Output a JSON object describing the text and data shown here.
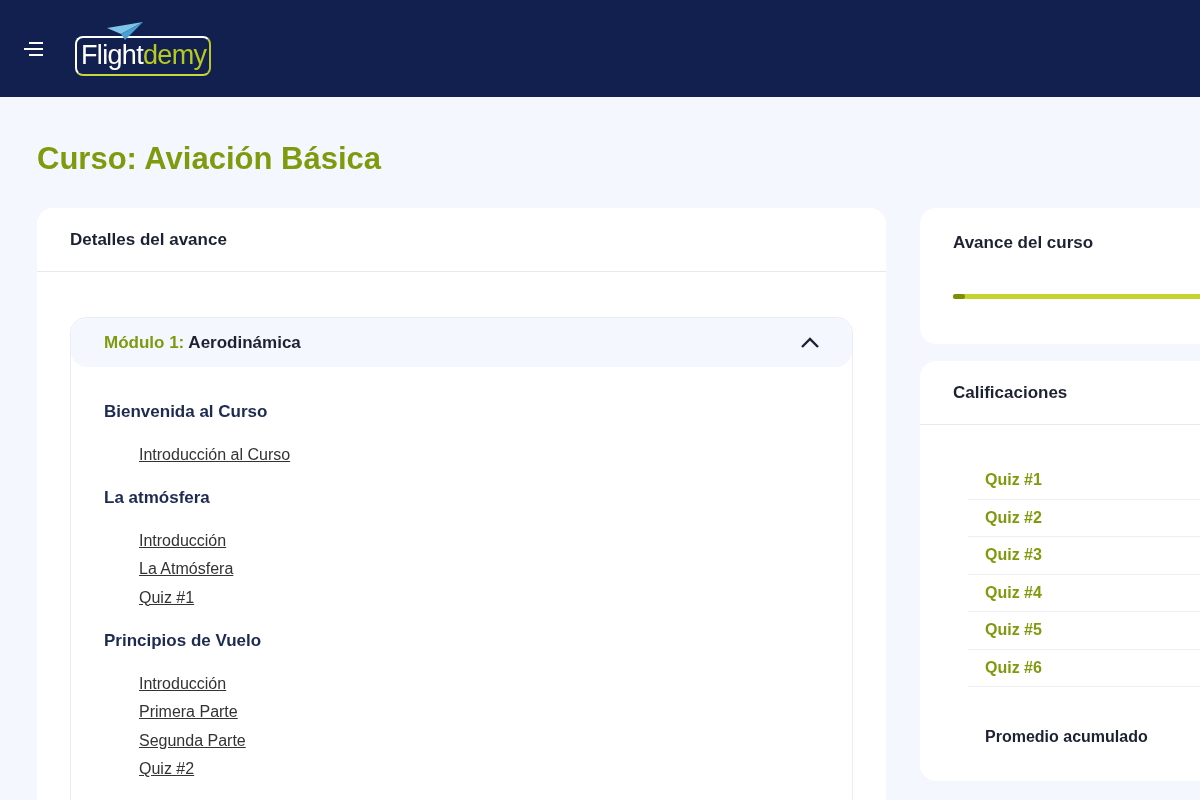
{
  "header": {
    "logo": {
      "part_1": "Flight",
      "part_2": "demy"
    }
  },
  "page_title": "Curso: Aviación Básica",
  "details_card": {
    "title": "Detalles del avance",
    "module": {
      "label": "Módulo 1:",
      "name": "Aerodinámica",
      "expanded": true,
      "sections": [
        {
          "title": "Bienvenida al Curso",
          "lessons": [
            "Introducción al Curso"
          ]
        },
        {
          "title": "La atmósfera",
          "lessons": [
            "Introducción",
            "La Atmósfera",
            "Quiz #1"
          ]
        },
        {
          "title": "Principios de Vuelo",
          "lessons": [
            "Introducción",
            "Primera Parte",
            "Segunda Parte",
            "Quiz #2"
          ]
        }
      ]
    }
  },
  "progress_card": {
    "title": "Avance del curso",
    "level": 0.04
  },
  "grades_card": {
    "title": "Calificaciones",
    "rows": [
      "Quiz #1",
      "Quiz #2",
      "Quiz #3",
      "Quiz #4",
      "Quiz #5",
      "Quiz #6"
    ],
    "average_label": "Promedio acumulado"
  }
}
